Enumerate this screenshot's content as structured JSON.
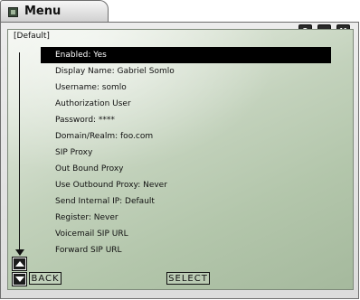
{
  "window": {
    "title": "Menu",
    "controls": [
      "?",
      "_",
      "X"
    ]
  },
  "breadcrumb": "[Default]",
  "menu": {
    "items": [
      "Enabled: Yes",
      "Display Name: Gabriel Somlo",
      "Username: somlo",
      "Authorization User",
      "Password: ****",
      "Domain/Realm: foo.com",
      "SIP Proxy",
      "Out Bound Proxy",
      "Use Outbound Proxy: Never",
      "Send Internal IP: Default",
      "Register: Never",
      "Voicemail SIP URL",
      "Forward SIP URL"
    ],
    "selected_index": 0
  },
  "softkeys": {
    "back": "BACK",
    "select": "SELECT"
  },
  "icons": {
    "app": "app-icon",
    "scroll_up": "up-arrow-icon",
    "scroll_down": "down-arrow-icon"
  }
}
